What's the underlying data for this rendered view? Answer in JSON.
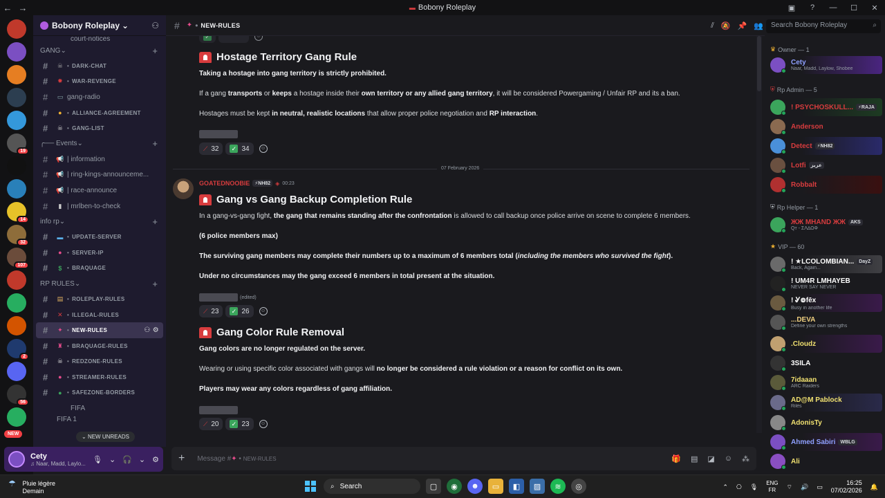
{
  "window": {
    "title": "Bobony Roleplay"
  },
  "guild": {
    "name": "Bobony Roleplay"
  },
  "sidebar": {
    "partial_top": "court-notices",
    "categories": [
      {
        "label": "GANG",
        "channels": [
          {
            "label": "DARK-CHAT",
            "emoji": "☠",
            "color": "#a0a0a0",
            "small": true
          },
          {
            "label": "WAR-REVENGE",
            "emoji": "✹",
            "color": "#d83c3e",
            "small": true
          },
          {
            "label": "gang-radio",
            "emoji": "▭",
            "color": "#8aa",
            "small": false
          },
          {
            "label": "ALLIANCE-AGREEMENT",
            "emoji": "●",
            "color": "#f0b232",
            "small": true
          },
          {
            "label": "GANG-LIST",
            "emoji": "☠",
            "color": "#ccc",
            "small": true
          }
        ]
      },
      {
        "label": "╭── Events",
        "channels": [
          {
            "label": "| information",
            "emoji": "▮",
            "color": "#ccc",
            "small": false,
            "icon": "announce"
          },
          {
            "label": "| ring-kings-announceme...",
            "emoji": "▮",
            "color": "#d83c3e",
            "small": false,
            "icon": "announce"
          },
          {
            "label": "| race-announce",
            "emoji": "▮",
            "color": "#d83c3e",
            "small": false,
            "icon": "announce"
          },
          {
            "label": "| mrlben-to-check",
            "emoji": "▮",
            "color": "#ccc",
            "small": false
          }
        ]
      },
      {
        "label": "info rp",
        "channels": [
          {
            "label": "UPDATE-SERVER",
            "emoji": "▬",
            "color": "#5ab0e8",
            "small": true
          },
          {
            "label": "SERVER-IP",
            "emoji": "●",
            "color": "#e74c8c",
            "small": true
          },
          {
            "label": "BRAQUAGE",
            "emoji": "$",
            "color": "#3ba55c",
            "small": true
          }
        ]
      },
      {
        "label": "RP RULES",
        "channels": [
          {
            "label": "ROLEPLAY-RULES",
            "emoji": "▤",
            "color": "#e0b060",
            "small": true
          },
          {
            "label": "ILLEGAL-RULES",
            "emoji": "✕",
            "color": "#d83c3e",
            "small": true
          },
          {
            "label": "NEW-RULES",
            "emoji": "✦",
            "color": "#e74c8c",
            "small": true,
            "active": true
          },
          {
            "label": "BRAQUAGE-RULES",
            "emoji": "♜",
            "color": "#e74c8c",
            "small": true
          },
          {
            "label": "REDZONE-RULES",
            "emoji": "☠",
            "color": "#ddd",
            "small": true
          },
          {
            "label": "STREAMER-RULES",
            "emoji": "●",
            "color": "#e74c8c",
            "small": true
          },
          {
            "label": "SAFEZONE-BORDERS",
            "emoji": "●",
            "color": "#3ba55c",
            "small": true
          }
        ]
      }
    ],
    "partial_bottom_1": "FIFA",
    "partial_bottom_2": "FIFA 1",
    "new_unreads": "NEW UNREADS",
    "new_badge": "NEW"
  },
  "user": {
    "name": "Cety",
    "status": "Naar, Madd, Laylo..."
  },
  "channel": {
    "name": "NEW-RULES"
  },
  "search": {
    "placeholder": "Search Bobony Roleplay"
  },
  "messages": {
    "m1": {
      "title": "Hostage Territory Gang Rule",
      "l1": "Taking a hostage into gang territory is strictly prohibited.",
      "l2_a": "If a gang ",
      "l2_b": "transports",
      "l2_c": " or ",
      "l2_d": "keeps",
      "l2_e": " a hostage inside their ",
      "l2_f": "own territory or any allied gang territory",
      "l2_g": ", it will be considered Powergaming / Unfair RP and its a ban.",
      "l3_a": "Hostages must be kept ",
      "l3_b": "in neutral, realistic locations",
      "l3_c": " that allow proper police negotiation and ",
      "l3_d": "RP interaction",
      "l3_e": ".",
      "r1": "32",
      "r2": "34"
    },
    "date_divider": "07 February 2026",
    "author": {
      "name": "GOATEDNOOBIE",
      "tag": "⚡NH82",
      "time": "00:23"
    },
    "m2": {
      "title": "Gang vs Gang Backup Completion Rule",
      "l1_a": "In a gang-vs-gang fight, ",
      "l1_b": "the gang that remains standing after the confrontation",
      "l1_c": " is allowed to call backup once police arrive on scene to complete 6 members.",
      "l2": "(6 police members max)",
      "l3_a": "The surviving gang members may complete their numbers up to a maximum of 6 members total (",
      "l3_b": "including the members who survived the fight",
      "l3_c": ").",
      "l4": "Under no circumstances may the gang exceed 6 members in total present at the situation.",
      "edited": "(edited)",
      "r1": "23",
      "r2": "26"
    },
    "m3": {
      "title": "Gang Color Rule Removal",
      "l1": "Gang colors are no longer regulated on the server.",
      "l2_a": "Wearing or using specific color associated with gangs will ",
      "l2_b": "no longer be considered a rule violation or a reason for conflict on its own.",
      "l3": "Players may wear any colors regardless of gang affiliation.",
      "r1": "20",
      "r2": "23"
    }
  },
  "composer": {
    "placeholder_prefix": "Message #",
    "placeholder_channel": "NEW-RULES"
  },
  "members": {
    "groups": [
      {
        "label": "Owner — 1"
      },
      {
        "label": "Rp Admin — 5"
      },
      {
        "label": "Rp Helper — 1"
      },
      {
        "label": "VIP — 60"
      }
    ],
    "list": [
      {
        "name": "Cety",
        "sub": "Naar, Madd, Laylow, Shobee",
        "color": "#8fa0ff",
        "av": "#7b4fc2",
        "hl": "#4a2580"
      },
      {
        "name": "! PSYCHOSKULL...",
        "tag": "⚡RAJA",
        "sub": "",
        "color": "#d83c3e",
        "av": "#3ba55c",
        "hl": "#1d3b22"
      },
      {
        "name": "Anderson",
        "sub": "",
        "color": "#d83c3e",
        "av": "#8a6a50"
      },
      {
        "name": "Detect",
        "tag": "⚡NH82",
        "sub": "",
        "color": "#d83c3e",
        "av": "#4a90d9",
        "hl": "#2a2a6a"
      },
      {
        "name": "Lotfi",
        "tag": "عزيز",
        "sub": "",
        "color": "#d83c3e",
        "av": "#6a5040"
      },
      {
        "name": "Robbalt",
        "sub": "",
        "color": "#d83c3e",
        "av": "#b03030",
        "hl": "#3a1010"
      },
      {
        "name": "ЖЖ MHAND ЖЖ",
        "tag": "AKS",
        "sub": "Qᴛ - ΣΛ∆ΩΦ",
        "color": "#d83c3e",
        "av": "#3ba55c"
      },
      {
        "name": "! ★LCOLOMBIAN...",
        "tag": "DayZ",
        "sub": "Back, Again...",
        "color": "#fff",
        "av": "#6a6a6a",
        "hl": "#404044"
      },
      {
        "name": "! UM4R LMHAYEB",
        "sub": "NEVER SAY NEVER",
        "color": "#fff",
        "av": "#222"
      },
      {
        "name": "! Ꮍ៙fēx",
        "sub": "Busy in another life",
        "color": "#fff",
        "av": "#6a5a40",
        "hl": "#3a1a4a"
      },
      {
        "name": "...DEVA",
        "sub": "Define your own strengths",
        "color": "#f0d080",
        "av": "#555"
      },
      {
        "name": ".Cloudz",
        "sub": "",
        "color": "#f0e070",
        "av": "#c0a070",
        "hl": "#3a1a4a"
      },
      {
        "name": "3SILA",
        "sub": "",
        "color": "#fff",
        "av": "#333"
      },
      {
        "name": "7idaaan",
        "sub": "ARC Raiders",
        "color": "#f0e070",
        "av": "#5a5a3a"
      },
      {
        "name": "AD@M Pablock",
        "sub": "Rilès",
        "color": "#f0e070",
        "av": "#6a6a8a",
        "hl": "#2a2a4a"
      },
      {
        "name": "AdonisTy",
        "sub": "",
        "color": "#f0e070",
        "av": "#888"
      },
      {
        "name": "Ahmed Sabiri",
        "tag": "WBLG",
        "sub": "",
        "color": "#8fa0ff",
        "av": "#7b4fc2",
        "hl": "#3a1a4a"
      },
      {
        "name": "Ali",
        "sub": "",
        "color": "#f0e070",
        "av": "#8a4fc2"
      }
    ]
  },
  "taskbar": {
    "weather": "Pluie légère",
    "weather_sub": "Demain",
    "search": "Search",
    "lang1": "ENG",
    "lang2": "FR",
    "time": "16:25",
    "date": "07/02/2026"
  },
  "servers": [
    {
      "color": "#c0392b",
      "badge": ""
    },
    {
      "color": "#7b4fc2",
      "badge": ""
    },
    {
      "color": "#e67e22",
      "badge": ""
    },
    {
      "color": "#2c3e50",
      "badge": ""
    },
    {
      "color": "#3498db",
      "badge": ""
    },
    {
      "color": "#555",
      "badge": "19"
    },
    {
      "color": "#111",
      "badge": ""
    },
    {
      "color": "#2980b9",
      "badge": ""
    },
    {
      "color": "#e6c229",
      "badge": "14"
    },
    {
      "color": "#8e6d3a",
      "badge": "32"
    },
    {
      "color": "#6b4c3b",
      "badge": "107"
    },
    {
      "color": "#c0392b",
      "badge": ""
    },
    {
      "color": "#27ae60",
      "badge": ""
    },
    {
      "color": "#d35400",
      "badge": ""
    },
    {
      "color": "#1f3a6e",
      "badge": "2"
    },
    {
      "color": "#5865f2",
      "badge": ""
    },
    {
      "color": "#333",
      "badge": "56"
    },
    {
      "color": "#27ae60",
      "badge": ""
    }
  ]
}
